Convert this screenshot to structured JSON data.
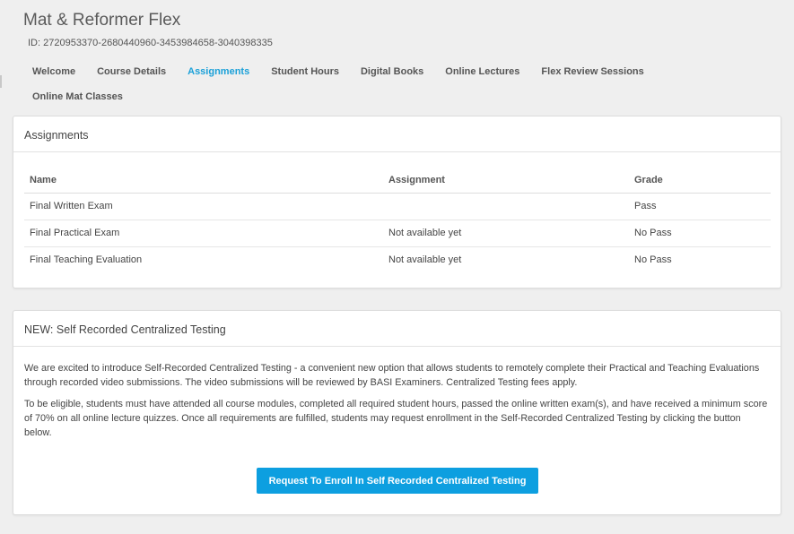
{
  "course": {
    "title": "Mat & Reformer Flex",
    "id_text": "ID: 2720953370-2680440960-3453984658-3040398335"
  },
  "tabs": [
    {
      "label": "Welcome",
      "active": false
    },
    {
      "label": "Course Details",
      "active": false
    },
    {
      "label": "Assignments",
      "active": true
    },
    {
      "label": "Student Hours",
      "active": false
    },
    {
      "label": "Digital Books",
      "active": false
    },
    {
      "label": "Online Lectures",
      "active": false
    },
    {
      "label": "Flex Review Sessions",
      "active": false
    },
    {
      "label": "Online Mat Classes",
      "active": false
    }
  ],
  "colors": {
    "accent": "#1aa0d8",
    "button": "#0d9fe0",
    "background": "#efefef"
  },
  "assignments": {
    "title": "Assignments",
    "columns": [
      "Name",
      "Assignment",
      "Grade"
    ],
    "rows": [
      {
        "name": "Final Written Exam",
        "assignment": "",
        "grade": "Pass"
      },
      {
        "name": "Final Practical Exam",
        "assignment": "Not available yet",
        "grade": "No Pass"
      },
      {
        "name": "Final Teaching Evaluation",
        "assignment": "Not available yet",
        "grade": "No Pass"
      }
    ]
  },
  "centralized": {
    "title": "NEW: Self Recorded Centralized Testing",
    "paragraph1": "We are excited to introduce Self-Recorded Centralized Testing - a convenient new option that allows students to remotely complete their Practical and Teaching Evaluations through recorded video submissions. The video submissions will be reviewed by BASI Examiners. Centralized Testing fees apply.",
    "paragraph2": "To be eligible, students must have attended all course modules, completed all required student hours, passed the online written exam(s), and have received a minimum score of 70% on all online lecture quizzes. Once all requirements are fulfilled, students may request enrollment in the Self-Recorded Centralized Testing by clicking the button below.",
    "button_label": "Request To Enroll In Self Recorded Centralized Testing"
  }
}
